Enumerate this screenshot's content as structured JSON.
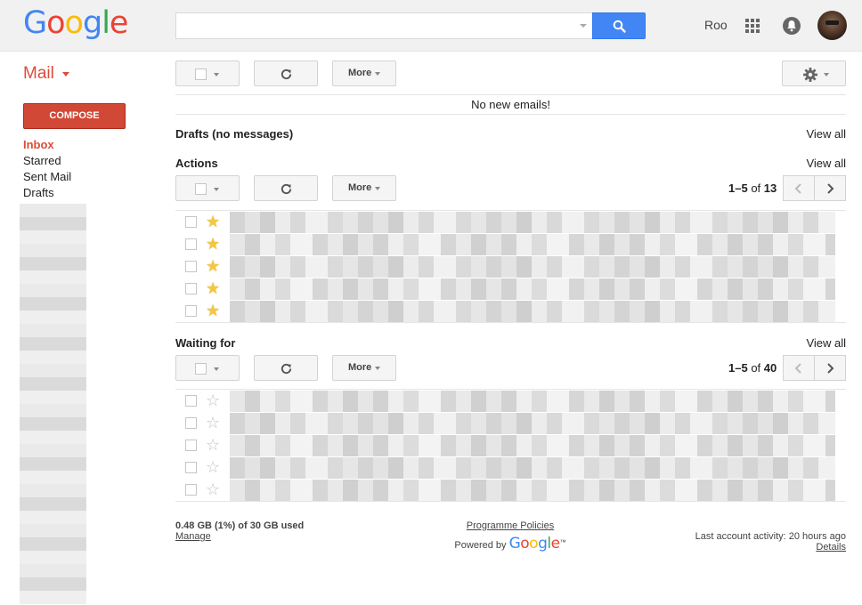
{
  "header": {
    "logo_letters": [
      "G",
      "o",
      "o",
      "g",
      "l",
      "e"
    ],
    "search": {
      "value": "",
      "placeholder": ""
    },
    "user_name": "Roo"
  },
  "sidebar": {
    "mail_label": "Mail",
    "compose_label": "COMPOSE",
    "items": [
      {
        "label": "Inbox",
        "active": true
      },
      {
        "label": "Starred",
        "active": false
      },
      {
        "label": "Sent Mail",
        "active": false
      },
      {
        "label": "Drafts",
        "active": false
      }
    ]
  },
  "toolbar": {
    "more_label": "More"
  },
  "main": {
    "empty_message": "No new emails!",
    "sections": {
      "drafts": {
        "title": "Drafts (no messages)",
        "view_all": "View all"
      },
      "actions": {
        "title": "Actions",
        "view_all": "View all",
        "range": "1–5",
        "of_label": "of",
        "total": "13",
        "more_label": "More",
        "rows": [
          {
            "starred": true
          },
          {
            "starred": true
          },
          {
            "starred": true
          },
          {
            "starred": true
          },
          {
            "starred": true
          }
        ]
      },
      "waiting": {
        "title": "Waiting for",
        "view_all": "View all",
        "range": "1–5",
        "of_label": "of",
        "total": "40",
        "more_label": "More",
        "rows": [
          {
            "starred": false
          },
          {
            "starred": false
          },
          {
            "starred": false
          },
          {
            "starred": false
          },
          {
            "starred": false
          }
        ]
      }
    }
  },
  "footer": {
    "quota": "0.48 GB (1%) of 30 GB used",
    "manage_label": "Manage",
    "policies_label": "Programme Policies",
    "powered_by": "Powered by",
    "powered_logo_letters": [
      "G",
      "o",
      "o",
      "g",
      "l",
      "e"
    ],
    "trademark": "™",
    "last_activity": "Last account activity: 20 hours ago",
    "details_label": "Details"
  },
  "colors": {
    "accent_red": "#dd4b39",
    "compose_bg": "#d14836",
    "search_blue": "#4285f4",
    "star_yellow": "#f4c642"
  }
}
